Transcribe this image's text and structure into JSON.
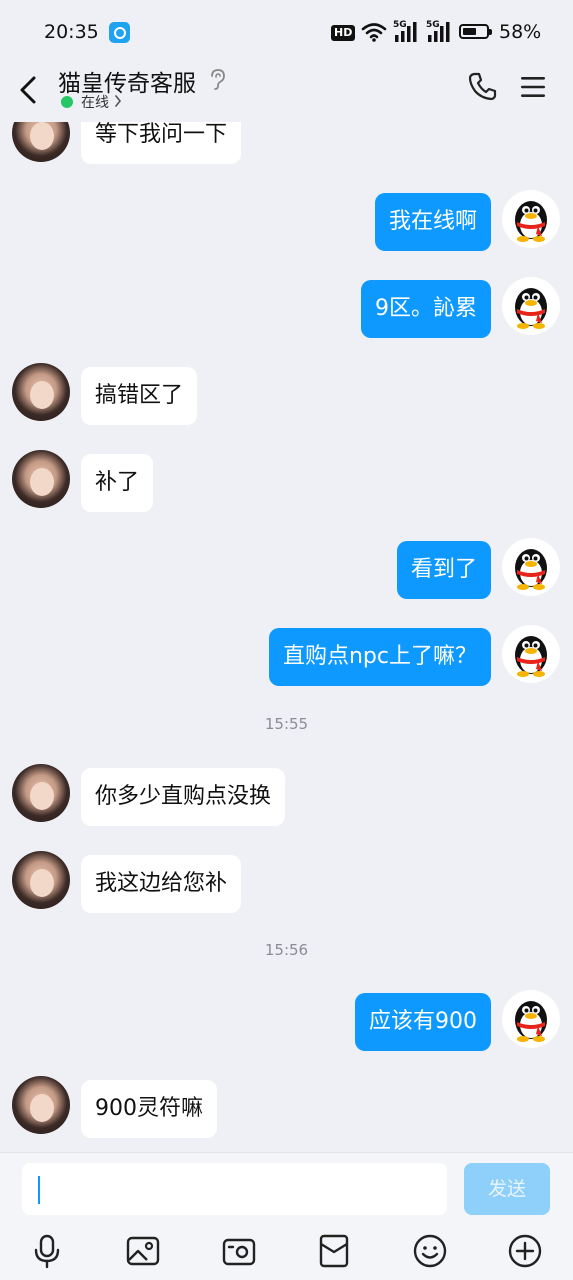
{
  "status_bar": {
    "time": "20:35",
    "hd_badge": "HD",
    "network_1": "5G",
    "network_2": "5G",
    "battery_percent": "58%",
    "battery_level": 0.58
  },
  "header": {
    "title": "猫皇传奇客服",
    "status": "在线",
    "status_color": "#24c763"
  },
  "messages": [
    {
      "side": "in",
      "text": "等下我问一下"
    },
    {
      "side": "out",
      "text": "我在线啊"
    },
    {
      "side": "out",
      "text": "9区。訫累"
    },
    {
      "side": "in",
      "text": "搞错区了"
    },
    {
      "side": "in",
      "text": "补了"
    },
    {
      "side": "out",
      "text": "看到了"
    },
    {
      "side": "out",
      "text": "直购点npc上了嘛？"
    },
    {
      "side": "time",
      "text": "15:55"
    },
    {
      "side": "in",
      "text": "你多少直购点没换"
    },
    {
      "side": "in",
      "text": "我这边给您补"
    },
    {
      "side": "time",
      "text": "15:56"
    },
    {
      "side": "out",
      "text": "应该有900"
    },
    {
      "side": "in",
      "text": "900灵符嘛"
    }
  ],
  "input": {
    "value": "",
    "send_label": "发送"
  },
  "toolbar": {
    "icons": [
      "microphone-icon",
      "image-icon",
      "camera-icon",
      "red-packet-icon",
      "emoji-icon",
      "plus-icon"
    ]
  },
  "colors": {
    "outgoing_bubble": "#0d99ff",
    "incoming_bubble": "#ffffff",
    "background": "#eef0f5"
  }
}
